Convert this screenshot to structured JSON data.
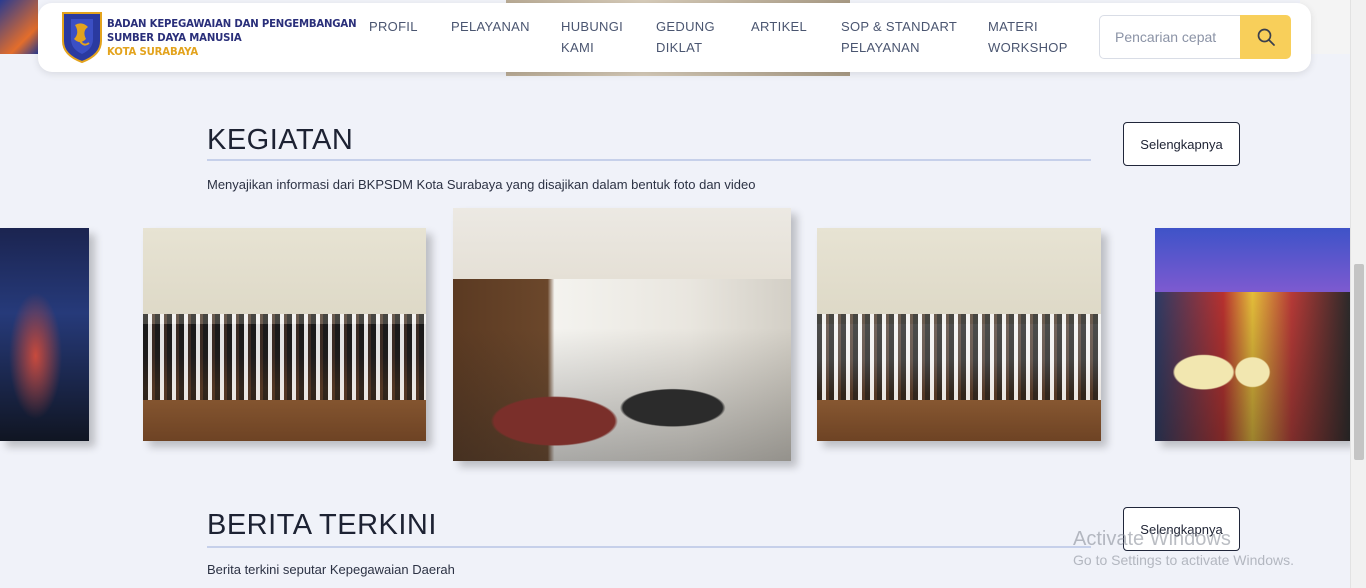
{
  "brand": {
    "line1": "BADAN KEPEGAWAIAN DAN PENGEMBANGAN",
    "line2": "SUMBER DAYA MANUSIA",
    "line3": "KOTA SURABAYA"
  },
  "nav": {
    "items": [
      {
        "line1": "PROFIL",
        "line2": ""
      },
      {
        "line1": "PELAYANAN",
        "line2": ""
      },
      {
        "line1": "HUBUNGI",
        "line2": "KAMI"
      },
      {
        "line1": "GEDUNG",
        "line2": "DIKLAT"
      },
      {
        "line1": "ARTIKEL",
        "line2": ""
      },
      {
        "line1": "SOP & STANDART",
        "line2": "PELAYANAN"
      },
      {
        "line1": "MATERI",
        "line2": "WORKSHOP"
      }
    ]
  },
  "search": {
    "placeholder": "Pencarian cepat",
    "icon": "search-icon"
  },
  "kegiatan": {
    "title": "KEGIATAN",
    "subtitle": "Menyajikan informasi dari BKPSDM Kota Surabaya yang disajikan dalam bentuk foto dan video",
    "more_label": "Selengkapnya"
  },
  "berita": {
    "title": "BERITA TERKINI",
    "subtitle": "Berita terkini seputar Kepegawaian Daerah",
    "more_label": "Selengkapnya"
  },
  "watermark": {
    "line1": "Activate Windows",
    "line2": "Go to Settings to activate Windows."
  },
  "colors": {
    "accent": "#f8cf5a",
    "brand_navy": "#2a2f7a",
    "brand_gold": "#e3a31d",
    "page_bg": "#f0f2f9"
  }
}
